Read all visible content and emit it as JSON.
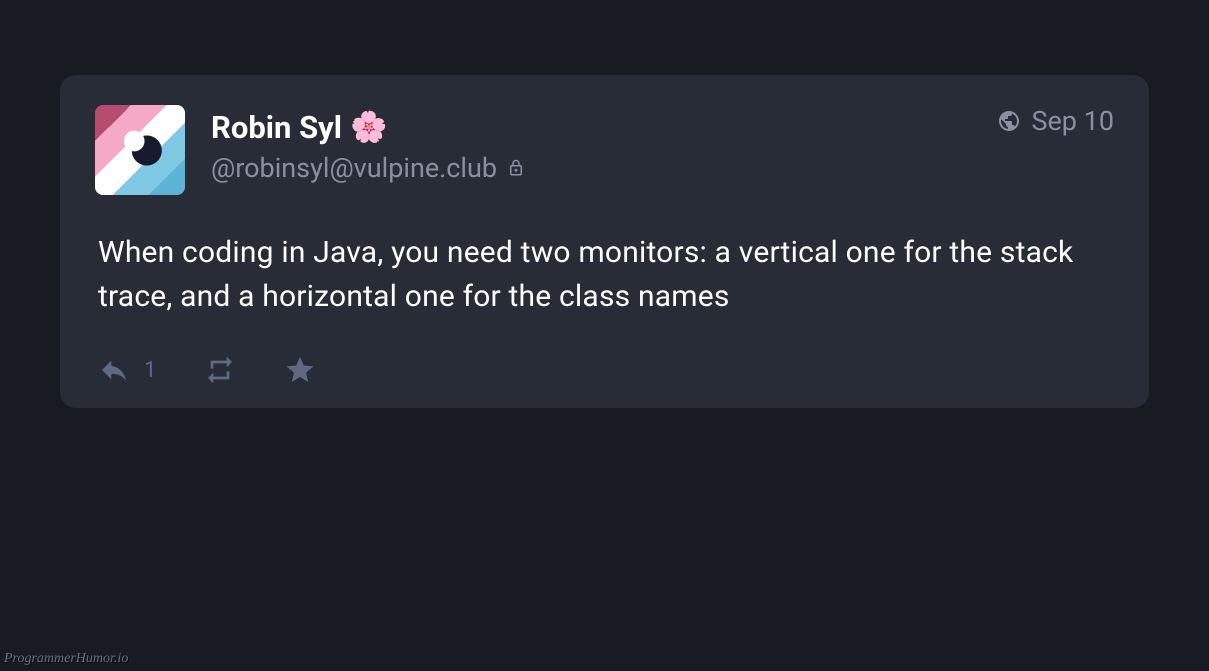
{
  "post": {
    "displayName": "Robin Syl",
    "emoji": "🌸",
    "handle": "@robinsyl@vulpine.club",
    "timestamp": "Sep 10",
    "content": "When coding in Java, you need two monitors: a vertical one for the stack trace, and a horizontal one for the class names",
    "replyCount": "1"
  },
  "watermark": "ProgrammerHumor.io"
}
